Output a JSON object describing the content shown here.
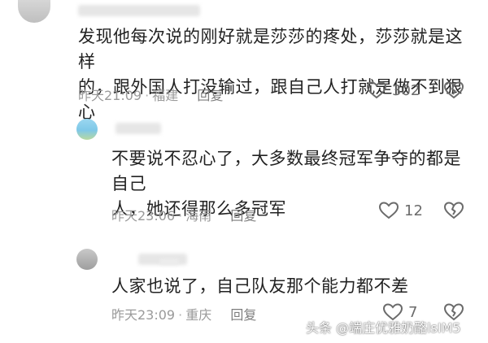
{
  "comments": [
    {
      "text_line1": "发现他每次说的刚好就是莎莎的疼处，莎莎就是这样",
      "text_line2": "的，跟外国人打没输过，跟自己人打就是做不到狠心",
      "time": "昨天21:09",
      "location": "福建",
      "reply_label": "回复",
      "likes": "302"
    },
    {
      "text_line1": "不要说不忍心了，大多数最终冠军争夺的都是自己",
      "text_line2": "人，她还得那么多冠军",
      "time": "昨天23:06",
      "location": "海南",
      "reply_label": "回复",
      "likes": "12"
    },
    {
      "text_line1": "人家也说了，自己队友那个能力都不差",
      "time": "昨天23:09",
      "location": "重庆",
      "reply_label": "回复",
      "likes": "7"
    }
  ],
  "watermark": "头条 @端庄优雅奶酪lsIM5",
  "icons": {
    "like": "heart-outline-icon",
    "dislike": "broken-heart-icon"
  },
  "colors": {
    "text": "#222222",
    "meta": "#9a9a9a",
    "icon": "#6b6b6b"
  }
}
